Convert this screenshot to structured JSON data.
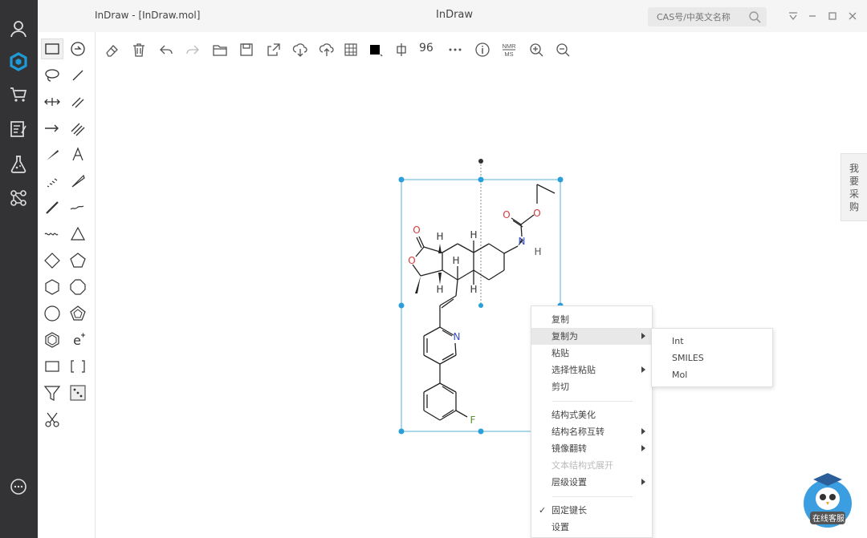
{
  "window": {
    "file_title": "InDraw - [InDraw.mol]",
    "app_title": "InDraw"
  },
  "search": {
    "placeholder": "CAS号/中英文名称"
  },
  "toolbar": {
    "font_size_value": "96"
  },
  "right_tab": {
    "label": "我要采购"
  },
  "context_menu": {
    "items": [
      {
        "label": "复制"
      },
      {
        "label": "复制为"
      },
      {
        "label": "粘贴"
      },
      {
        "label": "选择性粘贴"
      },
      {
        "label": "剪切"
      },
      {
        "label": "结构式美化"
      },
      {
        "label": "结构名称互转"
      },
      {
        "label": "镜像翻转"
      },
      {
        "label": "文本结构式展开"
      },
      {
        "label": "层级设置"
      },
      {
        "label": "固定键长"
      },
      {
        "label": "设置"
      }
    ],
    "submenu": [
      {
        "label": "Int"
      },
      {
        "label": "SMILES"
      },
      {
        "label": "Mol"
      }
    ]
  },
  "molecule": {
    "atoms": {
      "O1": "O",
      "O2": "O",
      "O3": "O",
      "O4": "O",
      "N1": "N",
      "N2": "N",
      "F": "F",
      "H1": "H",
      "H2": "H",
      "H3": "H",
      "H4": "H",
      "H5": "H"
    }
  },
  "mascot": {
    "label": "在线客服"
  },
  "colors": {
    "nav_bg": "#333335",
    "accent": "#1e9ad6",
    "oxygen": "#d9383a",
    "nitrogen": "#3a4fc2",
    "fluorine": "#5a8f3a",
    "selection": "#1e9ad6"
  }
}
